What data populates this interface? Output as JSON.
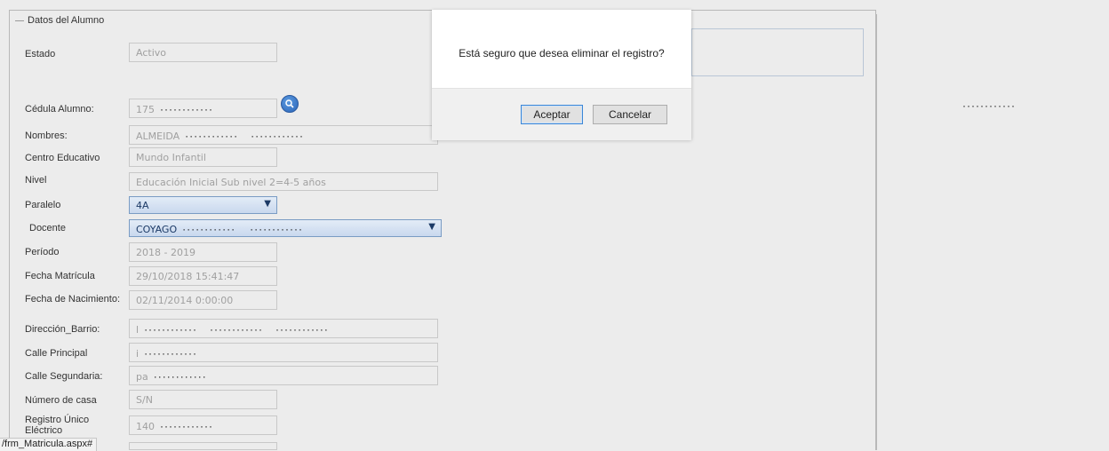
{
  "section": {
    "legend": "Datos del Alumno"
  },
  "fields": {
    "estado": {
      "label": "Estado",
      "value": "Activo"
    },
    "cedula": {
      "label": "Cédula Alumno:",
      "value": "175"
    },
    "nombres": {
      "label": "Nombres:",
      "value": "ALMEIDA"
    },
    "centro": {
      "label": "Centro Educativo",
      "value": "Mundo Infantil"
    },
    "nivel": {
      "label": "Nivel",
      "value": "Educación Inicial Sub nivel 2=4-5 años"
    },
    "paralelo": {
      "label": "Paralelo",
      "value": "4A"
    },
    "docente": {
      "label": "Docente",
      "value": "COYAGO"
    },
    "periodo": {
      "label": "Período",
      "value": "2018 - 2019"
    },
    "fecha_matricula": {
      "label": "Fecha Matrícula",
      "value": "29/10/2018 15:41:47"
    },
    "fecha_nacimiento": {
      "label": "Fecha de Nacimiento:",
      "value": "02/11/2014 0:00:00"
    },
    "direccion": {
      "label": "Dirección_Barrio:",
      "value": "l"
    },
    "calle_principal": {
      "label": "Calle Principal",
      "value": "i"
    },
    "calle_secundaria": {
      "label": "Calle Segundaria:",
      "value": "pa"
    },
    "numero_casa": {
      "label": "Número de casa",
      "value": "S/N"
    },
    "registro": {
      "label": "Registro Único Eléctrico",
      "value": "140"
    }
  },
  "redacted": "············",
  "dialog": {
    "message": "Está seguro que desea eliminar el registro?",
    "accept": "Aceptar",
    "cancel": "Cancelar"
  },
  "status_bar": {
    "url": "/frm_Matricula.aspx#"
  },
  "icons": {
    "search": "search-icon",
    "dropdown": "chevron-down-icon"
  },
  "colors": {
    "accent": "#2b65b8",
    "select_bg": "#c9d8ee"
  }
}
